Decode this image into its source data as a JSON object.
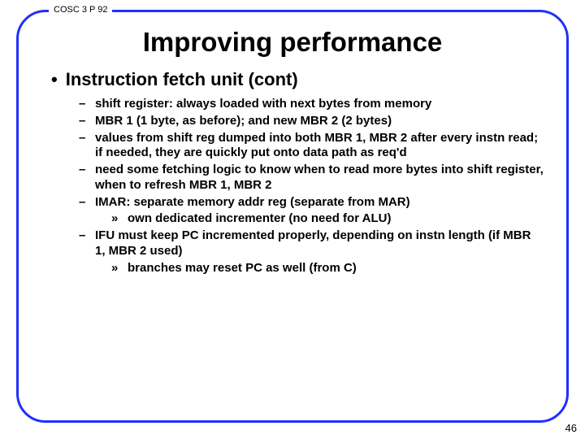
{
  "course": "COSC 3 P 92",
  "title": "Improving performance",
  "heading": "Instruction fetch unit (cont)",
  "bullets": [
    {
      "level": 2,
      "text": "shift register: always loaded with next bytes from memory"
    },
    {
      "level": 2,
      "text": "MBR 1 (1 byte, as before); and new MBR 2 (2 bytes)"
    },
    {
      "level": 2,
      "text": "values from shift reg dumped into both MBR 1, MBR 2 after every instn read; if needed, they are quickly put onto data path as req'd"
    },
    {
      "level": 2,
      "text": "need some fetching logic to know when to read more bytes into shift register, when to refresh MBR 1, MBR 2"
    },
    {
      "level": 2,
      "text": "IMAR: separate memory addr reg (separate from MAR)"
    },
    {
      "level": 3,
      "text": "own dedicated incrementer (no need for ALU)"
    },
    {
      "level": 2,
      "text": "IFU must keep PC incremented properly, depending on instn length (if MBR 1, MBR 2 used)"
    },
    {
      "level": 3,
      "text": "branches may reset PC as well (from C)"
    }
  ],
  "pageNumber": "46"
}
